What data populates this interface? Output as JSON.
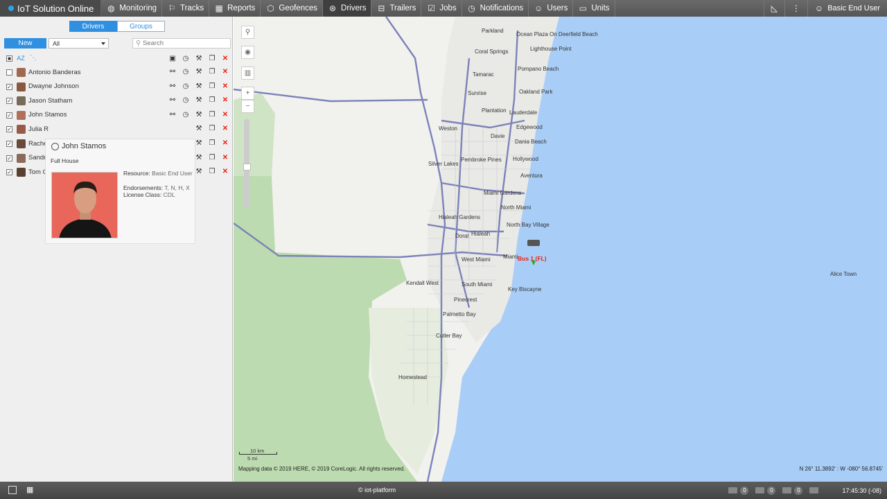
{
  "app": {
    "title": "IoT Solution Online"
  },
  "nav": [
    {
      "label": "Monitoring",
      "icon": "globe-icon"
    },
    {
      "label": "Tracks",
      "icon": "tracks-icon"
    },
    {
      "label": "Reports",
      "icon": "reports-icon"
    },
    {
      "label": "Geofences",
      "icon": "geofences-icon"
    },
    {
      "label": "Drivers",
      "icon": "steering-wheel-icon",
      "active": true
    },
    {
      "label": "Trailers",
      "icon": "trailer-icon"
    },
    {
      "label": "Jobs",
      "icon": "jobs-icon"
    },
    {
      "label": "Notifications",
      "icon": "alarm-clock-icon"
    },
    {
      "label": "Users",
      "icon": "user-icon"
    },
    {
      "label": "Units",
      "icon": "car-icon"
    }
  ],
  "user": {
    "name": "Basic End User"
  },
  "panel": {
    "tab_drivers": "Drivers",
    "tab_groups": "Groups",
    "new_button": "New",
    "filter_value": "All",
    "search_placeholder": "Search",
    "drivers": [
      {
        "name": "Antonio Banderas",
        "checked": false
      },
      {
        "name": "Dwayne Johnson",
        "checked": true
      },
      {
        "name": "Jason Statham",
        "checked": true
      },
      {
        "name": "John Stamos",
        "checked": true
      },
      {
        "name": "Julia R",
        "checked": true
      },
      {
        "name": "Rache",
        "checked": true
      },
      {
        "name": "Sandr",
        "checked": true
      },
      {
        "name": "Tom C",
        "checked": true
      }
    ]
  },
  "tooltip": {
    "name": "John Stamos",
    "subtitle": "Full House",
    "resource_label": "Resource:",
    "resource_value": "Basic End User",
    "endorsements_label": "Endorsements:",
    "endorsements_value": "T, N, H, X",
    "license_label": "License Class:",
    "license_value": "CDL"
  },
  "map": {
    "places": [
      "Parkland",
      "Ocean Plaza On Deerfield Beach",
      "Coral Springs",
      "Lighthouse Point",
      "Tamarac",
      "Pompano Beach",
      "Sunrise",
      "Oakland Park",
      "Plantation",
      "Lauderdale",
      "Weston",
      "Edgewood",
      "Davie",
      "Dania Beach",
      "Pembroke Pines",
      "Hollywood",
      "Silver Lakes",
      "Aventura",
      "Miami Gardens",
      "North Miami",
      "Hialeah Gardens",
      "North Bay Village",
      "Hialeah",
      "Doral",
      "West Miami",
      "Miami",
      "Kendall West",
      "South Miami",
      "Key Biscayne",
      "Pinecrest",
      "Palmetto Bay",
      "Cutler Bay",
      "Homestead",
      "Alice Town"
    ],
    "vehicle_label": "Bus 1 (FL)",
    "scale_km": "10 km",
    "scale_mi": "5 mi",
    "copyright": "Mapping data © 2019 HERE, © 2019 CoreLogic. All rights reserved.",
    "coordinates": "N 26° 11.3892' : W -080° 56.8745'"
  },
  "footer": {
    "copyright": "© iot-platform",
    "count1": "0",
    "count2": "0",
    "count3": "0",
    "time": "17:45:30 (-08)"
  }
}
